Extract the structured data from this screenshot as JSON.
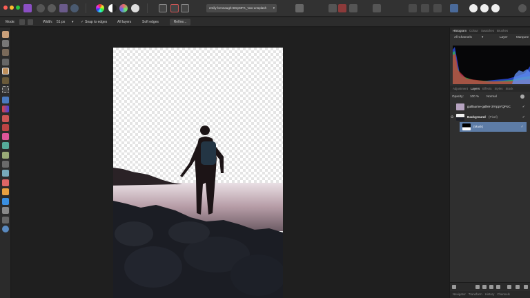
{
  "toolbar": {
    "document_name": "emily-kennaugh-tE5yMFK_Vao-unsplash",
    "caret": "▾"
  },
  "context": {
    "mode_label": "Mode:",
    "width_label": "Width:",
    "width_value": "51 px",
    "snap_label": "Snap to edges",
    "snap_check": "✓",
    "all_layers_label": "All layers",
    "soft_edges_label": "Soft edges",
    "refine_label": "Refine..."
  },
  "panels": {
    "top_tabs": [
      "Histogram",
      "Colour",
      "Swatches",
      "Brushes"
    ],
    "top_active": "Histogram",
    "histogram": {
      "channel": "All Channels",
      "source": "Layer",
      "mode": "Marquee"
    },
    "mid_tabs": [
      "Adjustment",
      "Layers",
      "Effects",
      "Styles",
      "Stock"
    ],
    "mid_active": "Layers",
    "opacity_label": "Opacity:",
    "opacity_value": "100 %",
    "blend_mode": "Normal",
    "layers": [
      {
        "name": "guillaume-gallier-3YrppYQPoC",
        "suffix": "",
        "checked": "✓"
      },
      {
        "name": "Background",
        "suffix": "(Pixel)",
        "checked": "✓"
      },
      {
        "name": "(Mask)",
        "suffix": "",
        "checked": "✓"
      }
    ],
    "bottom_tabs": [
      "Navigator",
      "Transform",
      "History",
      "Channels"
    ]
  },
  "colors": {
    "accent": "#5b7fb0",
    "selected_row": "#5d7ca6",
    "app_icon": "#8b4fc4"
  },
  "icons": {
    "app": "affinity-photo-icon",
    "mode_new": "new-selection-icon",
    "mode_add": "add-selection-icon"
  }
}
